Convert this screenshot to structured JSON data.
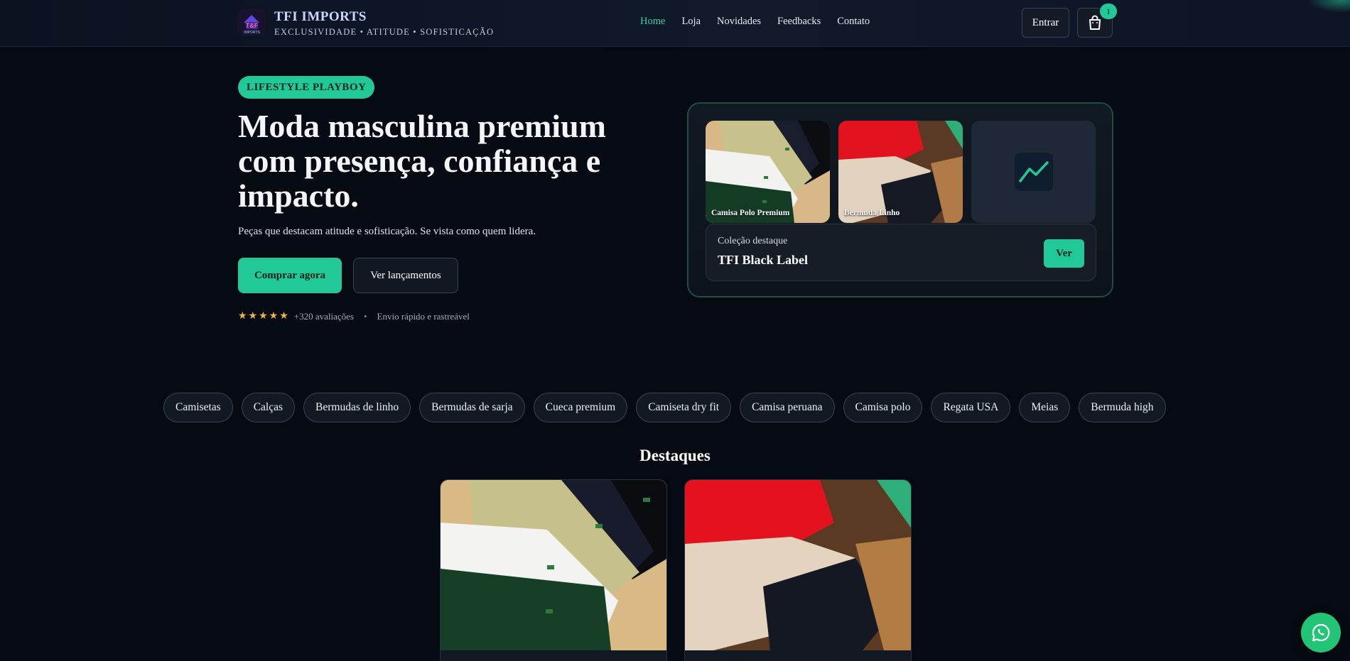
{
  "header": {
    "brand_name": "TFI IMPORTS",
    "brand_tagline": "EXCLUSIVIDADE • ATITUDE • SOFISTICAÇÃO",
    "logo_text": "T&F",
    "logo_subtext": "IMPORTS",
    "nav": [
      {
        "label": "Home",
        "active": true
      },
      {
        "label": "Loja",
        "active": false
      },
      {
        "label": "Novidades",
        "active": false
      },
      {
        "label": "Feedbacks",
        "active": false
      },
      {
        "label": "Contato",
        "active": false
      }
    ],
    "login_label": "Entrar",
    "cart_icon": "shopping-bag-icon",
    "cart_count": "1"
  },
  "hero": {
    "tag": "LIFESTYLE PLAYBOY",
    "title": "Moda masculina premium com presença, confiança e impacto.",
    "subtitle": "Peças que destacam atitude e sofisticação. Se vista como quem lidera.",
    "cta_primary": "Comprar agora",
    "cta_secondary": "Ver lançamentos",
    "stars": "★★★★★",
    "rating_text": "+320 avaliações",
    "separator": "•",
    "shipping_text": "Envio rápido e rastreável"
  },
  "feature": {
    "thumbs": [
      {
        "label": "Camisa Polo Premium"
      },
      {
        "label": "Bermuda Linho"
      },
      {
        "label": "",
        "icon": "trending-chart-icon"
      }
    ],
    "collection_small": "Coleção destaque",
    "collection_big": "TFI Black Label",
    "collection_button": "Ver"
  },
  "categories": [
    "Camisetas",
    "Calças",
    "Bermudas de linho",
    "Bermudas de sarja",
    "Cueca premium",
    "Camiseta dry fit",
    "Camisa peruana",
    "Camisa polo",
    "Regata USA",
    "Meias",
    "Bermuda high"
  ],
  "highlights": {
    "title": "Destaques"
  },
  "whatsapp_icon": "whatsapp-icon",
  "colors": {
    "accent": "#20c997",
    "background": "#060b13",
    "star": "#f2b53a",
    "whatsapp": "#22c576"
  }
}
